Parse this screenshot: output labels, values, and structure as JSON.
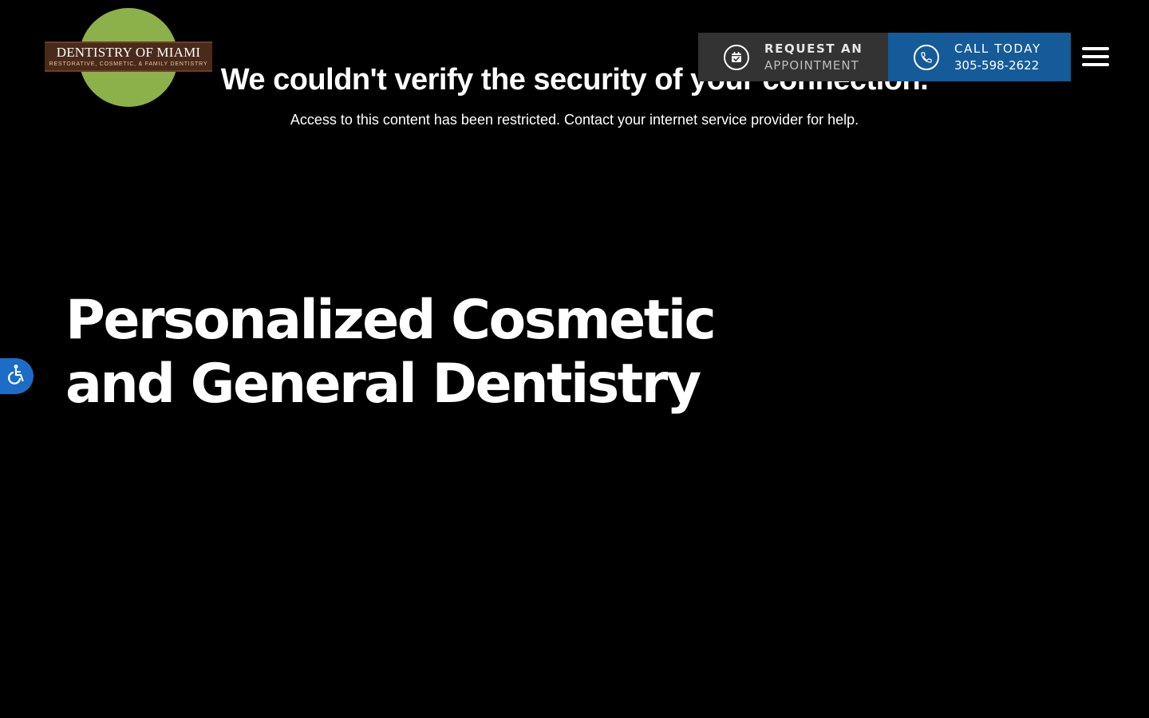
{
  "logo": {
    "name": "DENTISTRY OF MIAMI",
    "tagline": "RESTORATIVE, COSMETIC, & FAMILY DENTISTRY"
  },
  "security_notice": {
    "title": "We couldn't verify the security of your connection.",
    "message": "Access to this content has been restricted. Contact your internet service provider for help."
  },
  "header": {
    "appointment": {
      "line1": "REQUEST AN",
      "line2": "APPOINTMENT",
      "icon": "calendar-check-icon"
    },
    "call": {
      "line1": "CALL TODAY",
      "line2": "305-598-2622",
      "icon": "phone-icon"
    },
    "menu_icon": "hamburger-menu-icon"
  },
  "hero": {
    "line1": "Personalized Cosmetic",
    "line2": "and General Dentistry"
  },
  "accessibility": {
    "icon": "wheelchair-icon"
  },
  "colors": {
    "background": "#000000",
    "logo_green": "#8cb04a",
    "logo_brown": "#4a2a1a",
    "appointment_bg": "#333333",
    "call_bg": "#155b99",
    "accessibility_bg": "#1b6dc7"
  }
}
